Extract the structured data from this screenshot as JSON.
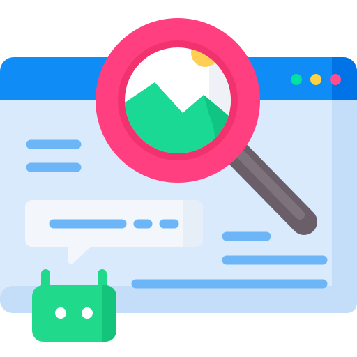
{
  "illustration": {
    "subject": "browser-window-image-search",
    "window_control_colors": [
      "#00e0a0",
      "#ffd23f",
      "#ff4d8d"
    ],
    "colors": {
      "window_bar": "#0f8cf5",
      "window_bar_shade": "#0073e6",
      "window_body": "#d8eafc",
      "window_body_shade": "#c4ddf8",
      "text_line": "#6cb5f7",
      "bubble": "#f3f7fc",
      "bot": "#21d98a",
      "lens_ring": "#ff3f7f",
      "lens_ring_shade": "#f2326f",
      "lens_glass": "#ffffff",
      "sun": "#ffcf55",
      "mountain": "#19d994",
      "handle": "#6a5f69"
    },
    "icons": [
      "magnifier-icon",
      "image-icon",
      "chat-bubble-icon",
      "bot-icon"
    ]
  }
}
